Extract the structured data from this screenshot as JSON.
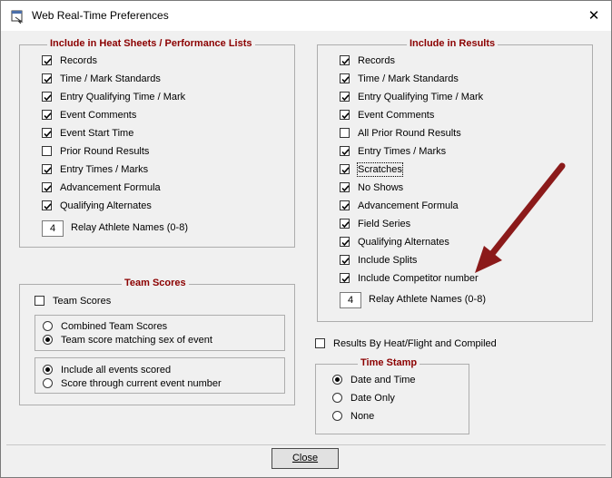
{
  "window": {
    "title": "Web Real-Time Preferences",
    "close_glyph": "✕"
  },
  "heat_sheets": {
    "title": "Include in Heat Sheets / Performance Lists",
    "items": [
      {
        "label": "Records",
        "checked": true
      },
      {
        "label": "Time / Mark Standards",
        "checked": true
      },
      {
        "label": "Entry Qualifying Time / Mark",
        "checked": true
      },
      {
        "label": "Event Comments",
        "checked": true
      },
      {
        "label": "Event Start Time",
        "checked": true
      },
      {
        "label": "Prior Round Results",
        "checked": false
      },
      {
        "label": "Entry Times / Marks",
        "checked": true
      },
      {
        "label": "Advancement Formula",
        "checked": true
      },
      {
        "label": "Qualifying Alternates",
        "checked": true
      }
    ],
    "relay_value": "4",
    "relay_label": "Relay Athlete Names (0-8)"
  },
  "results": {
    "title": "Include in Results",
    "items": [
      {
        "label": "Records",
        "checked": true
      },
      {
        "label": "Time / Mark Standards",
        "checked": true
      },
      {
        "label": "Entry Qualifying Time / Mark",
        "checked": true
      },
      {
        "label": "Event Comments",
        "checked": true
      },
      {
        "label": "All Prior Round Results",
        "checked": false
      },
      {
        "label": "Entry Times / Marks",
        "checked": true
      },
      {
        "label": "Scratches",
        "checked": true
      },
      {
        "label": "No Shows",
        "checked": true
      },
      {
        "label": "Advancement Formula",
        "checked": true
      },
      {
        "label": "Field Series",
        "checked": true
      },
      {
        "label": "Qualifying Alternates",
        "checked": true
      },
      {
        "label": "Include Splits",
        "checked": true
      },
      {
        "label": "Include Competitor number",
        "checked": true
      }
    ],
    "relay_value": "4",
    "relay_label": "Relay Athlete Names (0-8)"
  },
  "team_scores": {
    "title": "Team Scores",
    "checkbox_label": "Team Scores",
    "checked": false,
    "group1": [
      {
        "label": "Combined Team Scores",
        "selected": false
      },
      {
        "label": "Team score matching sex of event",
        "selected": true
      }
    ],
    "group2": [
      {
        "label": "Include all events scored",
        "selected": true
      },
      {
        "label": "Score through current event number",
        "selected": false
      }
    ]
  },
  "results_by_heat": {
    "label": "Results By Heat/Flight and Compiled",
    "checked": false
  },
  "time_stamp": {
    "title": "Time Stamp",
    "options": [
      {
        "label": "Date and Time",
        "selected": true
      },
      {
        "label": "Date Only",
        "selected": false
      },
      {
        "label": "None",
        "selected": false
      }
    ]
  },
  "footer": {
    "close_label": "Close"
  },
  "colors": {
    "section_title": "#8b0000",
    "annotation_arrow": "#8b1a1a"
  }
}
